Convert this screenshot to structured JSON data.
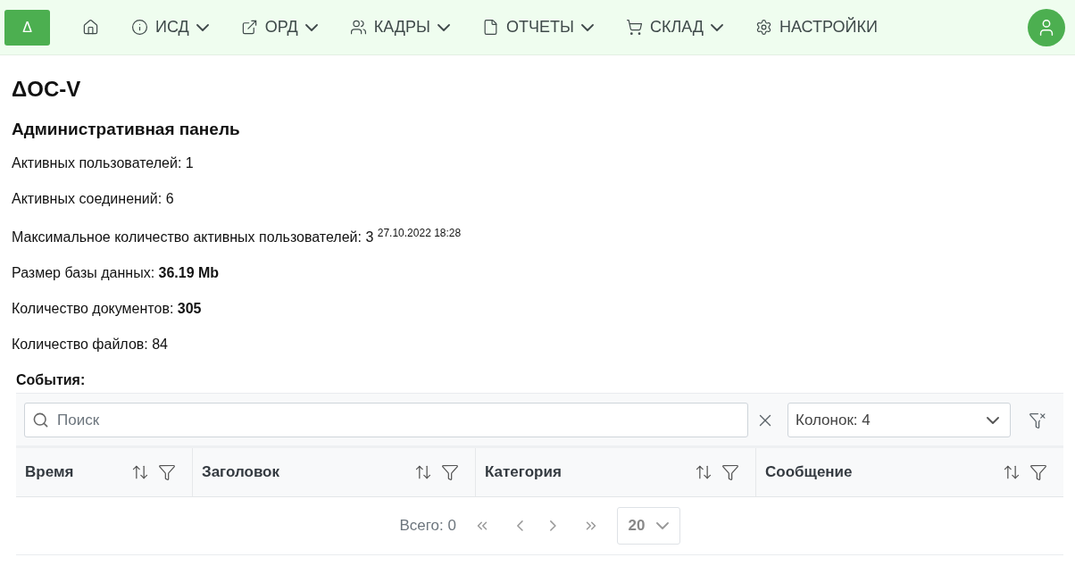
{
  "navbar": {
    "logo": "Δ",
    "items": [
      {
        "dropdown": false
      },
      {
        "label": "ИСД",
        "dropdown": true
      },
      {
        "label": "ОРД",
        "dropdown": true
      },
      {
        "label": "КАДРЫ",
        "dropdown": true
      },
      {
        "label": "ОТЧЕТЫ",
        "dropdown": true
      },
      {
        "label": "СКЛАД",
        "dropdown": true
      },
      {
        "label": "НАСТРОЙКИ",
        "dropdown": false
      }
    ]
  },
  "page": {
    "title": "ΔОС-V",
    "subtitle": "Административная панель",
    "stats": [
      "Активных пользователей: 1",
      "Активных соединений: 6",
      "Максимальное количество активных пользователей: 3 $^{27.10.2022 18:28}$",
      "Размер базы данных: **36.19 Mb**",
      "Количество документов: **305**",
      "Количество файлов: 84"
    ]
  },
  "events": {
    "title": "События:",
    "search": {
      "placeholder": "Поиск"
    },
    "columns_select": "Колонок: 4",
    "columns": [
      "Время",
      "Заголовок",
      "Категория",
      "Сообщение"
    ],
    "paginator": {
      "total": "Всего: 0",
      "page_size": "20"
    }
  }
}
